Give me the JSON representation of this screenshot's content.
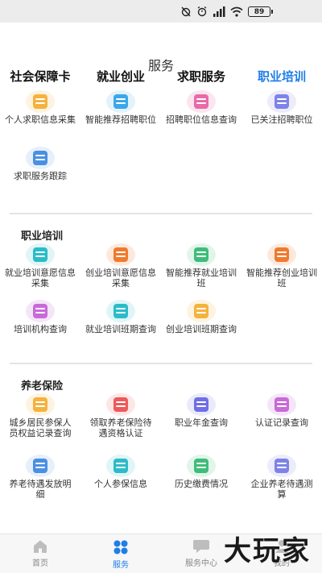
{
  "status": {
    "battery": "89"
  },
  "header": {
    "title": "服务"
  },
  "tabs": [
    {
      "label": "社会保障卡"
    },
    {
      "label": "就业创业"
    },
    {
      "label": "求职服务"
    },
    {
      "label": "职业培训"
    }
  ],
  "job_services": {
    "items": [
      {
        "label": "个人求职信息采集",
        "icon": "personal-job-info-icon",
        "color": "#f5b23d",
        "bg": "#fdf3e0"
      },
      {
        "label": "智能推荐招聘职位",
        "icon": "smart-recommend-job-icon",
        "color": "#3aa8e8",
        "bg": "#e3f2fb"
      },
      {
        "label": "招聘职位信息查询",
        "icon": "job-query-icon",
        "color": "#e96aa8",
        "bg": "#fbe6f0"
      },
      {
        "label": "已关注招聘职位",
        "icon": "followed-job-icon",
        "color": "#7e83e8",
        "bg": "#ececfb"
      },
      {
        "label": "求职服务跟踪",
        "icon": "job-tracking-icon",
        "color": "#4a8fe2",
        "bg": "#e6effb"
      }
    ]
  },
  "vocational_training": {
    "title": "职业培训",
    "items": [
      {
        "label": "就业培训意愿信息采集",
        "icon": "employment-training-intent-icon",
        "color": "#2bbcc8",
        "bg": "#e0f5f7"
      },
      {
        "label": "创业培训意愿信息采集",
        "icon": "startup-training-intent-icon",
        "color": "#f07a2e",
        "bg": "#fde9dc"
      },
      {
        "label": "智能推荐就业培训班",
        "icon": "recommend-employment-class-icon",
        "color": "#3ebd7a",
        "bg": "#e1f5ea"
      },
      {
        "label": "智能推荐创业培训班",
        "icon": "recommend-startup-class-icon",
        "color": "#f07a2e",
        "bg": "#fde9dc"
      },
      {
        "label": "培训机构查询",
        "icon": "training-institution-icon",
        "color": "#c86ad8",
        "bg": "#f4e6f8"
      },
      {
        "label": "就业培训班期查询",
        "icon": "employment-class-query-icon",
        "color": "#2bbcc8",
        "bg": "#e0f5f7"
      },
      {
        "label": "创业培训班期查询",
        "icon": "startup-class-query-icon",
        "color": "#f5b23d",
        "bg": "#fdf3e0"
      }
    ]
  },
  "pension": {
    "title": "养老保险",
    "items": [
      {
        "label": "城乡居民参保人员权益记录查询",
        "icon": "resident-insurance-record-icon",
        "color": "#f5b23d",
        "bg": "#fdf3e0"
      },
      {
        "label": "领取养老保险待遇资格认证",
        "icon": "pension-qualification-icon",
        "color": "#ee5a5a",
        "bg": "#fce6e6"
      },
      {
        "label": "职业年金查询",
        "icon": "occupational-annuity-icon",
        "color": "#6f6fe6",
        "bg": "#eaeafb"
      },
      {
        "label": "认证记录查询",
        "icon": "certification-record-icon",
        "color": "#c86ad8",
        "bg": "#f4e6f8"
      },
      {
        "label": "养老待遇发放明细",
        "icon": "pension-payment-detail-icon",
        "color": "#4a8fe2",
        "bg": "#e6effb"
      },
      {
        "label": "个人参保信息",
        "icon": "personal-insurance-info-icon",
        "color": "#2bbcc8",
        "bg": "#e0f5f7"
      },
      {
        "label": "历史缴费情况",
        "icon": "payment-history-icon",
        "color": "#3ebd7a",
        "bg": "#e1f5ea"
      },
      {
        "label": "企业养老待遇测算",
        "icon": "enterprise-pension-calc-icon",
        "color": "#7e83e8",
        "bg": "#ececfb"
      }
    ]
  },
  "tabbar": {
    "items": [
      {
        "label": "首页"
      },
      {
        "label": "服务"
      },
      {
        "label": "服务中心"
      },
      {
        "label": "我的"
      }
    ]
  },
  "watermark": "大玩家",
  "colors": {
    "accent": "#1f7ee8"
  }
}
